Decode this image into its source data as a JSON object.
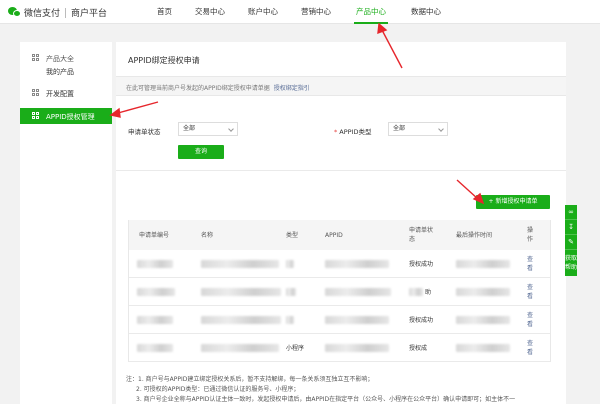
{
  "header": {
    "brand": "微信支付",
    "platform": "商户平台",
    "nav": [
      {
        "label": "首页"
      },
      {
        "label": "交易中心"
      },
      {
        "label": "账户中心"
      },
      {
        "label": "营销中心"
      },
      {
        "label": "产品中心",
        "active": true
      },
      {
        "label": "数据中心"
      }
    ]
  },
  "sidebar": {
    "group1_title": "产品大全",
    "group1_sub": "我的产品",
    "group2_title": "开发配置",
    "active_item": "APPID授权管理"
  },
  "main": {
    "title": "APPID绑定授权申请",
    "hint": "在此可管理当前商户号发起的APPID绑定授权申请单据",
    "hint_link": "授权绑定指引",
    "filter_status_label": "申请单状态",
    "filter_status_value": "全部",
    "filter_type_label": "APPID类型",
    "filter_type_value": "全部",
    "query_button": "查询",
    "add_button": "+ 新增授权申请单"
  },
  "table": {
    "headers": [
      "申请单编号",
      "名称",
      "类型",
      "APPID",
      "申请单状态",
      "最后操作时间",
      "操作"
    ],
    "rows": [
      {
        "type": "",
        "status": "授权成功",
        "action": "查看"
      },
      {
        "type": "",
        "status": "助",
        "action": "查看"
      },
      {
        "type": "",
        "status": "授权成功",
        "action": "查看"
      },
      {
        "type": "小程序",
        "status": "授权成",
        "action": "查看"
      }
    ]
  },
  "notes": {
    "n1": "注：1. 商户号与APPID建立绑定授权关系后，暂不支持解绑，每一条关系须互独立互不影响；",
    "n2": "2. 可授权的APPID类型：已通过微信认证的服务号、小程序；",
    "n3": "3. 商户号企业全称与APPID认证主体一致时，发起授权申请后，由APPID在指定平台（公众号、小程序在公众平台）确认申请即可；如主体不一"
  },
  "float_tool": {
    "label": "获取帮助"
  },
  "colors": {
    "accent": "#1aad19",
    "link": "#576b95",
    "annotation": "#e6262c"
  }
}
